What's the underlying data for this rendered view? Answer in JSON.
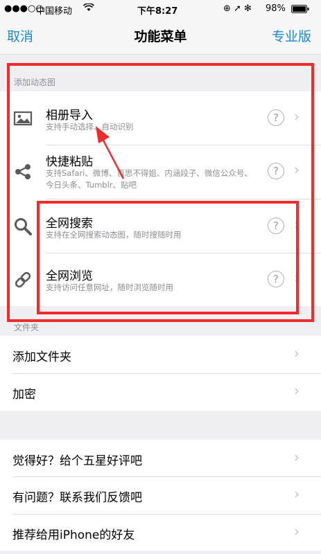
{
  "status": {
    "signal": "●●●○○",
    "carrier": "中国移动",
    "wifi": "wifi-icon",
    "time": "下午8:27",
    "right": "⊕ ➚ ✻ ",
    "battery": "98%"
  },
  "nav": {
    "left": "取消",
    "title": "功能菜单",
    "right": "专业版"
  },
  "dynamic_section": {
    "header": "添加动态图",
    "items": [
      {
        "title": "相册导入",
        "subtitle": "支持手动选择、自动识别",
        "icon": "image-icon"
      },
      {
        "title": "快捷粘贴",
        "subtitle": "支持Safari、微博、百思不得姐、内涵段子、微信公众号、今日头条、Tumblr、贴吧",
        "icon": "share-icon"
      },
      {
        "title": "全网搜索",
        "subtitle": "支持在全网搜索动态图，随时搜随时用",
        "icon": "search-icon"
      },
      {
        "title": "全网浏览",
        "subtitle": "支持访问任意网址，随时浏览随时用",
        "icon": "link-icon"
      }
    ]
  },
  "folder_section": {
    "header": "文件夹",
    "items": [
      "添加文件夹",
      "加密"
    ]
  },
  "misc_section": {
    "items": [
      "觉得好？给个五星好评吧",
      "有问题？联系我们反馈吧",
      "推荐给用iPhone的好友"
    ]
  },
  "help_glyph": "?",
  "chevron": "›",
  "annotation_color": "#ef2b2b"
}
